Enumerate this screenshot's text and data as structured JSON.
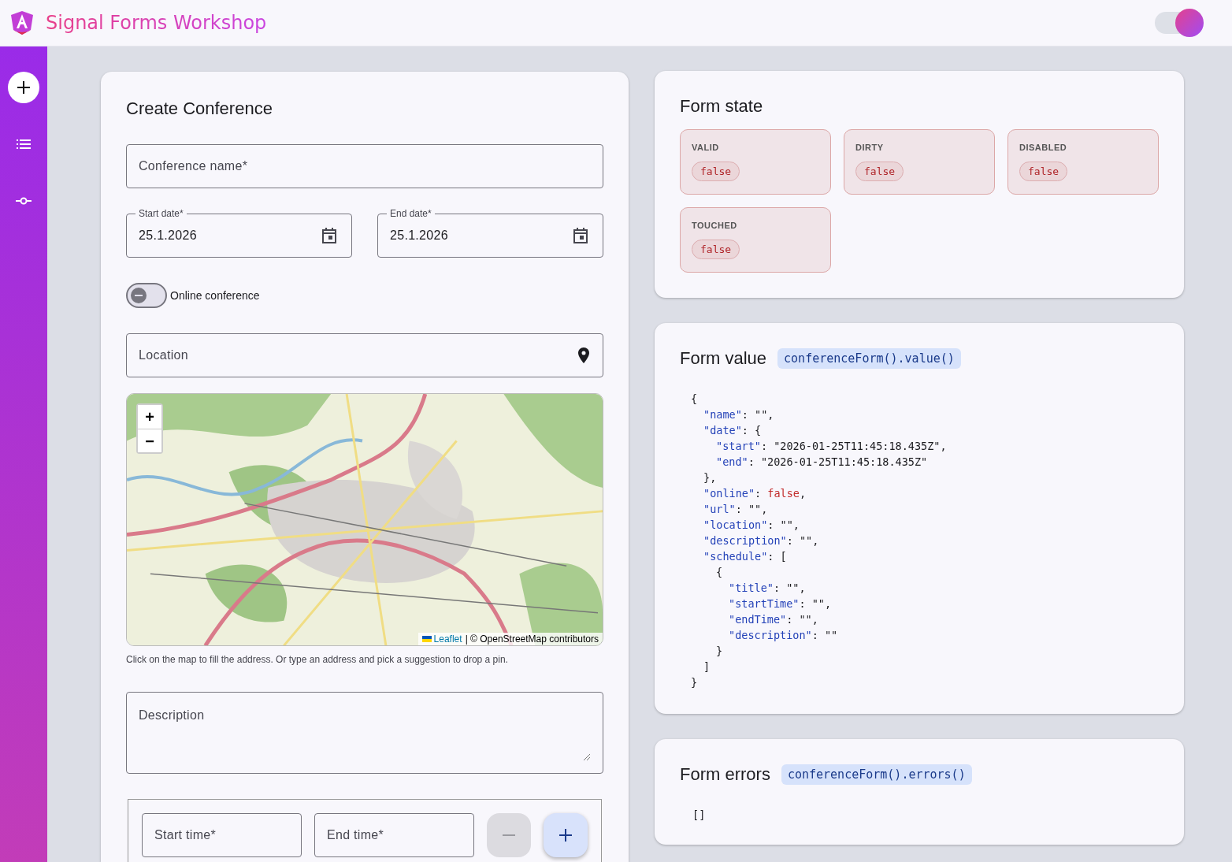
{
  "header": {
    "title": "Signal Forms Workshop",
    "theme_toggle": {
      "on": true
    }
  },
  "sidebar": {
    "items": [
      {
        "selected": true
      },
      {
        "selected": false
      },
      {
        "selected": false
      }
    ]
  },
  "create_form": {
    "title": "Create Conference",
    "name_field": {
      "placeholder": "Conference name*"
    },
    "start_date": {
      "label": "Start date*",
      "value": "25.1.2026"
    },
    "end_date": {
      "label": "End date*",
      "value": "25.1.2026"
    },
    "online": {
      "label": "Online conference",
      "checked": false
    },
    "location": {
      "placeholder": "Location"
    },
    "map": {
      "kind": "picture",
      "zoom_in": "+",
      "zoom_out": "−",
      "attribution_link": "Leaflet",
      "attribution_text": "| © OpenStreetMap contributors"
    },
    "map_hint": "Click on the map to fill the address. Or type an address and pick a suggestion to drop a pin.",
    "description": {
      "placeholder": "Description"
    },
    "schedule": {
      "start_time": {
        "placeholder": "Start time*"
      },
      "end_time": {
        "placeholder": "End time*"
      },
      "remove_disabled": true,
      "add_disabled": false
    }
  },
  "form_state": {
    "title": "Form state",
    "flags": [
      {
        "label": "VALID",
        "value": "false"
      },
      {
        "label": "DIRTY",
        "value": "false"
      },
      {
        "label": "DISABLED",
        "value": "false"
      },
      {
        "label": "TOUCHED",
        "value": "false"
      }
    ]
  },
  "form_value": {
    "title": "Form value",
    "code_tag": "conferenceForm().value()",
    "lines": [
      {
        "tokens": [
          {
            "kind": "punct",
            "text": "{"
          }
        ],
        "children": [
          {
            "tokens": [
              {
                "kind": "key",
                "text": "\"name\""
              },
              {
                "kind": "punct",
                "text": ": \"\","
              }
            ]
          },
          {
            "tokens": [
              {
                "kind": "key",
                "text": "\"date\""
              },
              {
                "kind": "punct",
                "text": ": {"
              }
            ],
            "children": [
              {
                "tokens": [
                  {
                    "kind": "key",
                    "text": "\"start\""
                  },
                  {
                    "kind": "punct",
                    "text": ": \"2026-01-25T11:45:18.435Z\","
                  }
                ]
              },
              {
                "tokens": [
                  {
                    "kind": "key",
                    "text": "\"end\""
                  },
                  {
                    "kind": "punct",
                    "text": ": \"2026-01-25T11:45:18.435Z\""
                  }
                ]
              }
            ]
          },
          {
            "tokens": [
              {
                "kind": "punct",
                "text": "},"
              }
            ]
          },
          {
            "tokens": [
              {
                "kind": "key",
                "text": "\"online\""
              },
              {
                "kind": "punct",
                "text": ": "
              },
              {
                "kind": "bool",
                "text": "false"
              },
              {
                "kind": "punct",
                "text": ","
              }
            ]
          },
          {
            "tokens": [
              {
                "kind": "key",
                "text": "\"url\""
              },
              {
                "kind": "punct",
                "text": ": \"\","
              }
            ]
          },
          {
            "tokens": [
              {
                "kind": "key",
                "text": "\"location\""
              },
              {
                "kind": "punct",
                "text": ": \"\","
              }
            ]
          },
          {
            "tokens": [
              {
                "kind": "key",
                "text": "\"description\""
              },
              {
                "kind": "punct",
                "text": ": \"\","
              }
            ]
          },
          {
            "tokens": [
              {
                "kind": "key",
                "text": "\"schedule\""
              },
              {
                "kind": "punct",
                "text": ": ["
              }
            ],
            "children": [
              {
                "tokens": [
                  {
                    "kind": "punct",
                    "text": "{"
                  }
                ],
                "children": [
                  {
                    "tokens": [
                      {
                        "kind": "key",
                        "text": "\"title\""
                      },
                      {
                        "kind": "punct",
                        "text": ": \"\","
                      }
                    ]
                  },
                  {
                    "tokens": [
                      {
                        "kind": "key",
                        "text": "\"startTime\""
                      },
                      {
                        "kind": "punct",
                        "text": ": \"\","
                      }
                    ]
                  },
                  {
                    "tokens": [
                      {
                        "kind": "key",
                        "text": "\"endTime\""
                      },
                      {
                        "kind": "punct",
                        "text": ": \"\","
                      }
                    ]
                  },
                  {
                    "tokens": [
                      {
                        "kind": "key",
                        "text": "\"description\""
                      },
                      {
                        "kind": "punct",
                        "text": ": \"\""
                      }
                    ]
                  }
                ]
              },
              {
                "tokens": [
                  {
                    "kind": "punct",
                    "text": "}"
                  }
                ]
              }
            ]
          },
          {
            "tokens": [
              {
                "kind": "punct",
                "text": "]"
              }
            ]
          }
        ]
      },
      {
        "tokens": [
          {
            "kind": "punct",
            "text": "}"
          }
        ]
      }
    ]
  },
  "form_errors": {
    "title": "Form errors",
    "code_tag": "conferenceForm().errors()",
    "value": "[]"
  }
}
